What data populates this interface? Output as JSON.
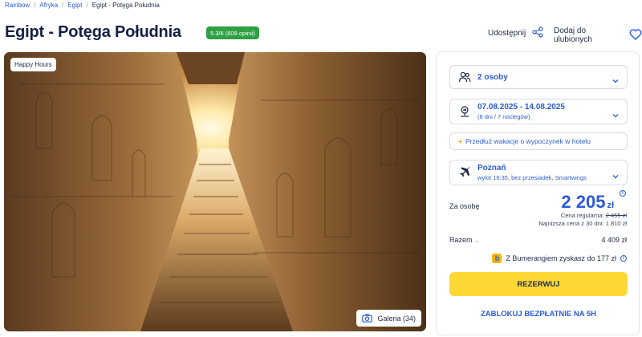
{
  "breadcrumb": [
    "Rainbow",
    "Afryka",
    "Egipt",
    "Egipt - Potęga Południa"
  ],
  "title": "Egipt - Potęga Południa",
  "rating": "5.3/6 (608 opinii)",
  "actions": {
    "share": "Udostępnij",
    "favorite": "Dodaj do ulubionych"
  },
  "hero": {
    "tag": "Happy Hours",
    "gallery": "Galeria (34)"
  },
  "booking": {
    "persons": "2 osoby",
    "dates": "07.08.2025 - 14.08.2025",
    "dates_sub": "(8 dni / 7 noclegów)",
    "extend": "Przedłuż wakacje o wypoczynek w hotelu",
    "departure": "Poznań",
    "departure_sub": "wylot 16:35, bez przesiadek, Smartwings"
  },
  "pricing": {
    "per_person_label": "Za osobę",
    "price": "2 205",
    "currency": "zł",
    "regular_label": "Cena regularna:",
    "regular_price": "2 455 zł",
    "lowest": "Najniższa cena z 30 dni: 1 810 zł",
    "total_label": "Razem",
    "total": "4 409 zł",
    "bumerang": "Z Bumerangiem zyskasz do 177 zł"
  },
  "buttons": {
    "reserve": "REZERWUJ",
    "block": "ZABLOKUJ BEZPŁATNIE NA 5H"
  },
  "colors": {
    "accent": "#2a5bd7",
    "cta": "#fdd835",
    "rating": "#2ea043"
  }
}
